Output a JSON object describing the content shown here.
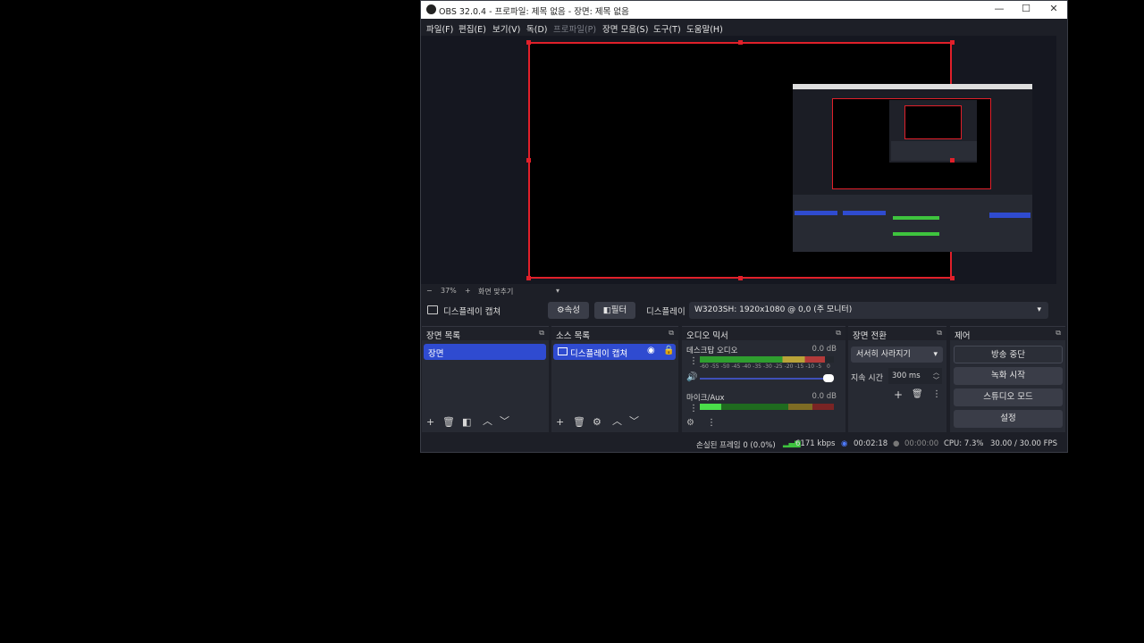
{
  "window": {
    "title": "OBS 32.0.4 - 프로파일: 제목 없음 - 장면: 제목 없음",
    "controls": {
      "minimize": "—",
      "maximize": "☐",
      "close": "✕"
    }
  },
  "menu": {
    "file": "파일(F)",
    "edit": "편집(E)",
    "view": "보기(V)",
    "dock": "독(D)",
    "profile": "프로파일(P)",
    "scene_collection": "장면 모음(S)",
    "tools": "도구(T)",
    "help": "도움말(H)"
  },
  "zoom": {
    "minus": "−",
    "value": "37%",
    "plus": "+",
    "fit": "화면 맞추기",
    "dropdown": "▾"
  },
  "source_toolbar": {
    "source_name": "디스플레이 캡쳐",
    "properties": "속성",
    "filters": "필터",
    "display_label": "디스플레이",
    "display_value": "W3203SH: 1920x1080 @ 0,0 (주 모니터)"
  },
  "scenes": {
    "title": "장면 목록",
    "items": [
      "장면"
    ]
  },
  "sources": {
    "title": "소스 목록",
    "items": [
      "디스플레이 캡쳐"
    ]
  },
  "mixer": {
    "title": "오디오 믹서",
    "channels": [
      {
        "name": "데스크탑 오디오",
        "db": "0.0 dB",
        "level": 0.93
      },
      {
        "name": "마이크/Aux",
        "db": "0.0 dB",
        "level": 0.16
      }
    ],
    "ticks": [
      "-60",
      "-55",
      "-50",
      "-45",
      "-40",
      "-35",
      "-30",
      "-25",
      "-20",
      "-15",
      "-10",
      "-5",
      "0"
    ]
  },
  "transitions": {
    "title": "장면 전환",
    "selected": "서서히 사라지기",
    "duration_label": "지속 시간",
    "duration_value": "300 ms"
  },
  "controls": {
    "title": "제어",
    "stop_streaming": "방송 중단",
    "start_recording": "녹화 시작",
    "studio_mode": "스튜디오 모드",
    "settings": "설정"
  },
  "status": {
    "dropped": "손실된 프레임 0 (0.0%)",
    "bitrate": "6171 kbps",
    "stream_time": "00:02:18",
    "rec_time": "00:00:00",
    "cpu": "CPU: 7.3%",
    "fps": "30.00 / 30.00 FPS"
  },
  "colors": {
    "accent": "#2f4bd0",
    "canvas_border": "#e0202a",
    "meter_green": "#3ec43e",
    "meter_yellow": "#c8b43a",
    "meter_red": "#c43a3a"
  }
}
